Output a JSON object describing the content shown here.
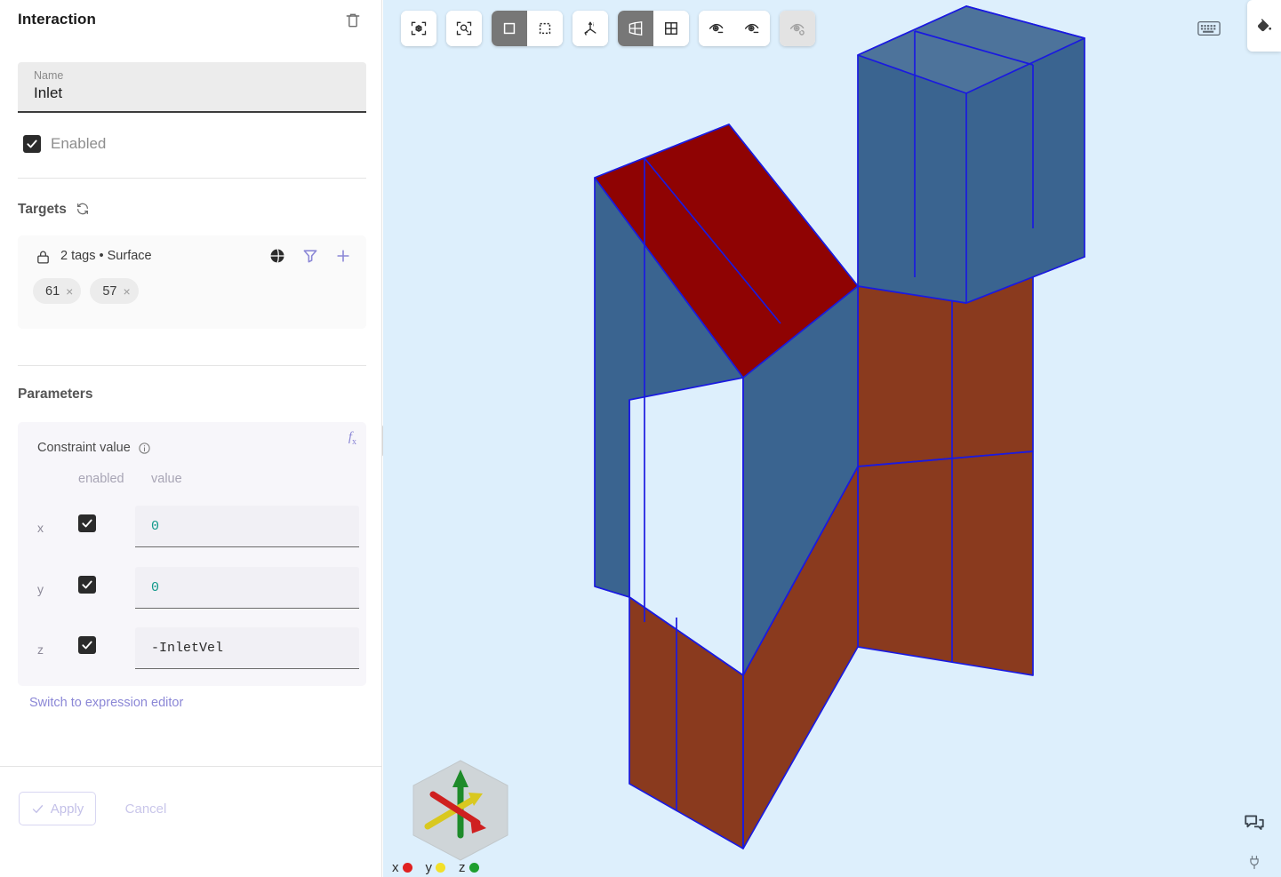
{
  "sidebar": {
    "title": "Interaction",
    "delete_icon": "trash-icon",
    "name_field": {
      "label": "Name",
      "value": "Inlet"
    },
    "enabled": {
      "label": "Enabled",
      "checked": true
    },
    "targets": {
      "title": "Targets",
      "refresh_icon": "refresh-icon",
      "lock_icon": "lock-icon",
      "summary": "2 tags • Surface",
      "actions": [
        "globe-icon",
        "filter-icon",
        "plus-icon"
      ],
      "chips": [
        {
          "label": "61",
          "remove": "×"
        },
        {
          "label": "57",
          "remove": "×"
        }
      ]
    },
    "parameters": {
      "title": "Parameters",
      "fx_label": "f",
      "fx_sub": "x",
      "constraint_title": "Constraint value",
      "info_icon": "info-icon",
      "columns": {
        "enabled": "enabled",
        "value": "value"
      },
      "rows": [
        {
          "axis": "x",
          "enabled": true,
          "value": "0",
          "kind": "number"
        },
        {
          "axis": "y",
          "enabled": true,
          "value": "0",
          "kind": "number"
        },
        {
          "axis": "z",
          "enabled": true,
          "value": "-InletVel",
          "kind": "expression"
        }
      ],
      "switch_link": "Switch to expression editor"
    },
    "footer": {
      "apply": "Apply",
      "cancel": "Cancel"
    }
  },
  "viewport": {
    "background_color": "#ddeffc",
    "toolbar": [
      {
        "group": [
          {
            "icon": "fit-to-view-icon",
            "active": false
          }
        ]
      },
      {
        "group": [
          {
            "icon": "zoom-to-box-icon",
            "active": false
          }
        ]
      },
      {
        "group": [
          {
            "icon": "select-solid-icon",
            "active": true
          },
          {
            "icon": "select-box-icon",
            "active": false
          }
        ]
      },
      {
        "group": [
          {
            "icon": "axis-tripod-icon",
            "active": false
          }
        ]
      },
      {
        "group": [
          {
            "icon": "perspective-view-icon",
            "active": true
          },
          {
            "icon": "grid-view-icon",
            "active": false
          }
        ]
      },
      {
        "group": [
          {
            "icon": "eye-hide-icon",
            "active": false
          },
          {
            "icon": "eye-show-icon",
            "active": false
          }
        ]
      },
      {
        "group": [
          {
            "icon": "eye-reset-icon",
            "active": false,
            "disabled": true
          }
        ]
      }
    ],
    "keyboard_icon": "keyboard-icon",
    "fill-color-icon": "paint-bucket-icon",
    "chat_icon": "chat-bubble-icon",
    "plug_icon": "plug-icon",
    "gizmo": {
      "axes": [
        {
          "label": "x",
          "color": "#e02020"
        },
        {
          "label": "y",
          "color": "#f2e02a"
        },
        {
          "label": "z",
          "color": "#1e9e2e"
        }
      ]
    },
    "geometry": {
      "face_blue": "#3a6490",
      "face_brown": "#8a3a1e",
      "face_selected_red": "#960404",
      "edge_color": "#1a1ae0"
    }
  }
}
